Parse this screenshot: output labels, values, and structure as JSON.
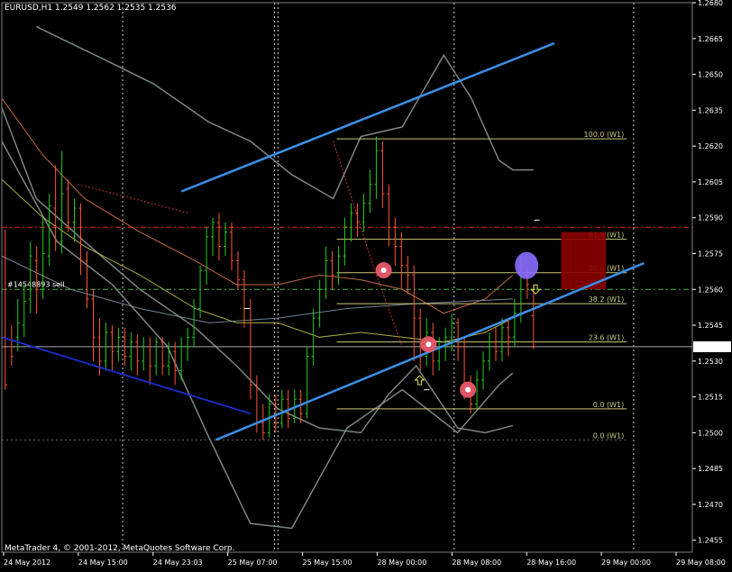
{
  "window": {
    "title": "EURUSD,H1  1.2549 1.2562 1.2535 1.2536",
    "footer": "MetaTrader 4, © 2001-2012, MetaQuotes Software Corp."
  },
  "colors": {
    "background": "#000000",
    "bull_candle": "#22cc22",
    "bear_candle": "#ff5533",
    "channel": "#3b8fe8",
    "lower_trend": "#1a2fd0",
    "fibo": "#c8c87a",
    "order_line": "#4caf50",
    "resistance": "#cc2222",
    "zone": "#8b0000",
    "bands": "#8a9590"
  },
  "order_label": "#14548893 sell",
  "current_price_tag": "1.2536",
  "chart_data": {
    "type": "candlestick",
    "symbol": "EURUSD",
    "timeframe": "H1",
    "ohlc_header": {
      "open": 1.2549,
      "high": 1.2562,
      "low": 1.2535,
      "close": 1.2536
    },
    "ylim": [
      1.245,
      1.268
    ],
    "y_ticks": [
      "1.2680",
      "1.2665",
      "1.2650",
      "1.2635",
      "1.2620",
      "1.2605",
      "1.2590",
      "1.2575",
      "1.2560",
      "1.2545",
      "1.2530",
      "1.2515",
      "1.2500",
      "1.2485",
      "1.2470",
      "1.2455"
    ],
    "x_ticks": [
      "24 May 2012",
      "24 May 15:00",
      "24 May 23:03",
      "25 May 07:00",
      "25 May 15:00",
      "28 May 00:00",
      "28 May 08:00",
      "28 May 16:00",
      "29 May 00:00",
      "29 May 08:00"
    ],
    "fibonacci": {
      "levels": [
        {
          "label": "100.0 (W1)",
          "price": 1.2623
        },
        {
          "label": "61.8 (W1)",
          "price": 1.2581
        },
        {
          "label": "50.0 (W1)",
          "price": 1.2567
        },
        {
          "label": "38.2 (W1)",
          "price": 1.2554
        },
        {
          "label": "23.6 (W1)",
          "price": 1.2538
        },
        {
          "label": "0.0 (W1)",
          "price": 1.251
        },
        {
          "label": "0.0 (W1)",
          "price": 1.2497
        }
      ]
    },
    "sell_order_price": 1.256,
    "resistance_price": 1.2586,
    "current_price": 1.2536,
    "channel_upper": [
      {
        "t": 0.26,
        "p": 1.2601
      },
      {
        "t": 0.8,
        "p": 1.2663
      }
    ],
    "channel_lower": [
      {
        "t": 0.31,
        "p": 1.2497
      },
      {
        "t": 0.93,
        "p": 1.2571
      }
    ],
    "candles": [
      [
        1.254,
        1.252,
        1.2585,
        1.2518
      ],
      [
        1.2536,
        1.2532,
        1.2545,
        1.2528
      ],
      [
        1.254,
        1.2546,
        1.2556,
        1.2534
      ],
      [
        1.2545,
        1.2555,
        1.2562,
        1.254
      ],
      [
        1.2556,
        1.2574,
        1.258,
        1.255
      ],
      [
        1.2572,
        1.256,
        1.2578,
        1.255
      ],
      [
        1.256,
        1.2575,
        1.259,
        1.2556
      ],
      [
        1.2574,
        1.2595,
        1.26,
        1.257
      ],
      [
        1.2594,
        1.258,
        1.2612,
        1.2576
      ],
      [
        1.258,
        1.26,
        1.2618,
        1.2575
      ],
      [
        1.2602,
        1.2588,
        1.2606,
        1.2584
      ],
      [
        1.2588,
        1.2594,
        1.2598,
        1.258
      ],
      [
        1.2594,
        1.2572,
        1.2596,
        1.2566
      ],
      [
        1.2572,
        1.2556,
        1.2576,
        1.2552
      ],
      [
        1.2556,
        1.254,
        1.256,
        1.253
      ],
      [
        1.254,
        1.253,
        1.2548,
        1.2524
      ],
      [
        1.253,
        1.2542,
        1.2546,
        1.2526
      ],
      [
        1.2542,
        1.2534,
        1.2545,
        1.2526
      ],
      [
        1.2534,
        1.254,
        1.2544,
        1.253
      ],
      [
        1.254,
        1.2532,
        1.2544,
        1.2528
      ],
      [
        1.2532,
        1.2538,
        1.2542,
        1.2526
      ],
      [
        1.2538,
        1.253,
        1.2541,
        1.2524
      ],
      [
        1.253,
        1.2536,
        1.254,
        1.2526
      ],
      [
        1.2536,
        1.2528,
        1.254,
        1.252
      ],
      [
        1.2528,
        1.2538,
        1.254,
        1.2524
      ],
      [
        1.2538,
        1.2528,
        1.254,
        1.2524
      ],
      [
        1.2528,
        1.2534,
        1.2538,
        1.2524
      ],
      [
        1.2534,
        1.2526,
        1.2538,
        1.252
      ],
      [
        1.2526,
        1.2536,
        1.254,
        1.2522
      ],
      [
        1.2536,
        1.254,
        1.2544,
        1.253
      ],
      [
        1.254,
        1.2552,
        1.2556,
        1.2536
      ],
      [
        1.2552,
        1.2568,
        1.257,
        1.2548
      ],
      [
        1.2568,
        1.2582,
        1.2586,
        1.2562
      ],
      [
        1.2582,
        1.2588,
        1.259,
        1.2574
      ],
      [
        1.2588,
        1.2578,
        1.2592,
        1.2572
      ],
      [
        1.2578,
        1.2584,
        1.2588,
        1.2574
      ],
      [
        1.2584,
        1.2572,
        1.2588,
        1.2568
      ],
      [
        1.2572,
        1.2564,
        1.2576,
        1.256
      ],
      [
        1.2564,
        1.2552,
        1.2568,
        1.2544
      ],
      [
        1.2552,
        1.252,
        1.2556,
        1.2514
      ],
      [
        1.252,
        1.2504,
        1.2524,
        1.25
      ],
      [
        1.2504,
        1.25,
        1.2512,
        1.2497
      ],
      [
        1.25,
        1.2512,
        1.2516,
        1.2498
      ],
      [
        1.2512,
        1.2504,
        1.2516,
        1.25
      ],
      [
        1.2504,
        1.2514,
        1.2518,
        1.2502
      ],
      [
        1.2514,
        1.2506,
        1.2518,
        1.2502
      ],
      [
        1.2506,
        1.2514,
        1.2518,
        1.2504
      ],
      [
        1.2514,
        1.2508,
        1.2518,
        1.2504
      ],
      [
        1.2508,
        1.2532,
        1.2536,
        1.2506
      ],
      [
        1.2532,
        1.2548,
        1.2552,
        1.2528
      ],
      [
        1.2548,
        1.256,
        1.2564,
        1.2544
      ],
      [
        1.256,
        1.2572,
        1.2578,
        1.2556
      ],
      [
        1.2572,
        1.2566,
        1.2576,
        1.256
      ],
      [
        1.2566,
        1.2574,
        1.2578,
        1.2562
      ],
      [
        1.2574,
        1.2586,
        1.259,
        1.257
      ],
      [
        1.2586,
        1.2592,
        1.2596,
        1.258
      ],
      [
        1.2592,
        1.2588,
        1.2596,
        1.2582
      ],
      [
        1.2588,
        1.2596,
        1.26,
        1.2584
      ],
      [
        1.2596,
        1.2604,
        1.261,
        1.2592
      ],
      [
        1.2604,
        1.2618,
        1.2624,
        1.2598
      ],
      [
        1.2618,
        1.26,
        1.2622,
        1.2594
      ],
      [
        1.26,
        1.2586,
        1.2604,
        1.2578
      ],
      [
        1.2586,
        1.2578,
        1.259,
        1.257
      ],
      [
        1.2578,
        1.257,
        1.2584,
        1.256
      ],
      [
        1.257,
        1.2566,
        1.2574,
        1.2558
      ],
      [
        1.2566,
        1.2548,
        1.257,
        1.253
      ],
      [
        1.2548,
        1.2532,
        1.2552,
        1.2526
      ],
      [
        1.2532,
        1.2542,
        1.2548,
        1.2528
      ],
      [
        1.2542,
        1.253,
        1.2546,
        1.2524
      ],
      [
        1.253,
        1.2536,
        1.254,
        1.2526
      ],
      [
        1.2536,
        1.254,
        1.2544,
        1.253
      ],
      [
        1.254,
        1.2546,
        1.255,
        1.2534
      ],
      [
        1.2546,
        1.2536,
        1.2548,
        1.253
      ],
      [
        1.2536,
        1.252,
        1.254,
        1.2514
      ],
      [
        1.252,
        1.2512,
        1.2524,
        1.2508
      ],
      [
        1.2512,
        1.2522,
        1.2526,
        1.251
      ],
      [
        1.2522,
        1.253,
        1.2534,
        1.2518
      ],
      [
        1.253,
        1.2538,
        1.2542,
        1.2526
      ],
      [
        1.2538,
        1.2534,
        1.2544,
        1.253
      ],
      [
        1.2534,
        1.2544,
        1.2548,
        1.253
      ],
      [
        1.2544,
        1.254,
        1.2548,
        1.2532
      ],
      [
        1.254,
        1.255,
        1.2556,
        1.2536
      ],
      [
        1.255,
        1.2566,
        1.2574,
        1.2546
      ],
      [
        1.2566,
        1.2562,
        1.257,
        1.2556
      ],
      [
        1.2549,
        1.2536,
        1.2562,
        1.2535
      ]
    ]
  }
}
